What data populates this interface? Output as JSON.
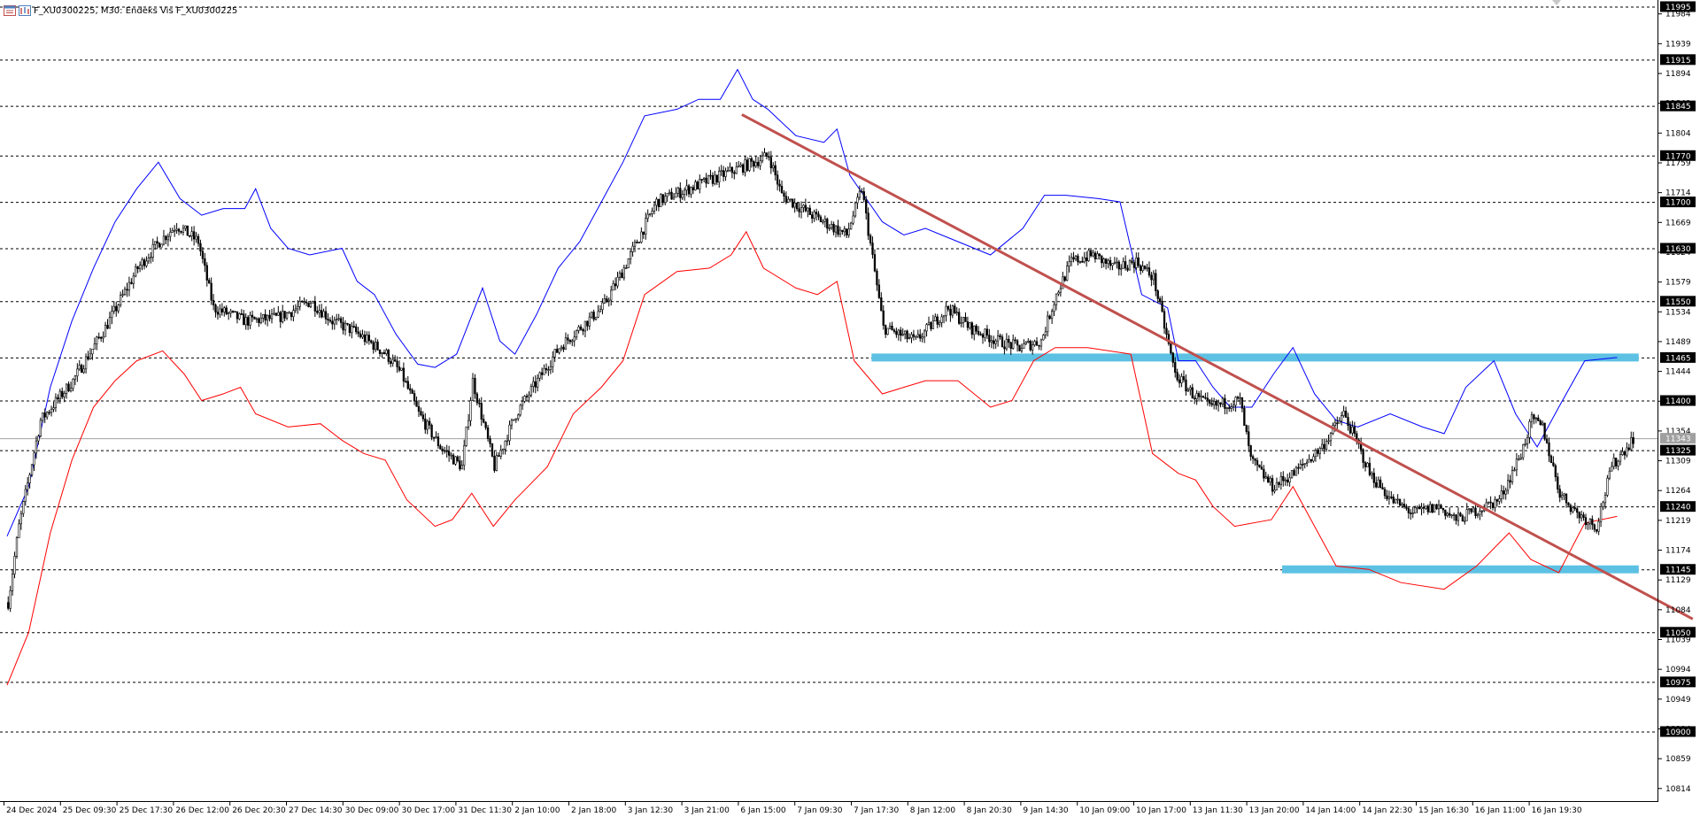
{
  "window": {
    "title": "F_XU0300225, M30:  Endeks Vis F_XU0300225",
    "icons": [
      "chart-window-icon",
      "indicator-list-icon"
    ]
  },
  "colors": {
    "candle": "#000000",
    "upper_band": "#0000ff",
    "lower_band": "#ff0000",
    "trendline": "#c0504d",
    "zone": "#5dc1e3",
    "grid": "#000000",
    "price_line": "#a0a0a0"
  },
  "chart_data": {
    "type": "candlestick",
    "symbol": "F_XU0300225",
    "timeframe": "M30",
    "title": "F_XU0300225, M30:  Endeks Vis F_XU0300225",
    "ylim": [
      10795,
      12005
    ],
    "y_tick_labels": [
      11984,
      11939,
      11894,
      11849,
      11804,
      11759,
      11714,
      11669,
      11624,
      11579,
      11534,
      11489,
      11444,
      11399,
      11354,
      11309,
      11264,
      11219,
      11174,
      11129,
      11084,
      11039,
      10994,
      10949,
      10904,
      10859,
      10814
    ],
    "horizontal_levels": [
      11995,
      11915,
      11845,
      11770,
      11700,
      11630,
      11550,
      11465,
      11400,
      11325,
      11240,
      11145,
      11050,
      10975,
      10900
    ],
    "current_price": 11343,
    "x_labels": [
      "24 Dec 2024",
      "25 Dec 09:30",
      "25 Dec 17:30",
      "26 Dec 12:00",
      "26 Dec 20:30",
      "27 Dec 14:30",
      "30 Dec 09:00",
      "30 Dec 17:00",
      "31 Dec 11:30",
      "2 Jan 10:00",
      "2 Jan 18:00",
      "3 Jan 12:30",
      "3 Jan 21:00",
      "6 Jan 15:00",
      "7 Jan 09:30",
      "7 Jan 17:30",
      "8 Jan 12:00",
      "8 Jan 20:30",
      "9 Jan 14:30",
      "10 Jan 09:00",
      "10 Jan 17:00",
      "13 Jan 11:30",
      "13 Jan 20:00",
      "14 Jan 14:00",
      "14 Jan 22:30",
      "15 Jan 16:30",
      "16 Jan 11:00",
      "16 Jan 19:30"
    ],
    "close_path": [
      [
        0,
        11095
      ],
      [
        5,
        11210
      ],
      [
        15,
        11370
      ],
      [
        30,
        11430
      ],
      [
        45,
        11510
      ],
      [
        60,
        11600
      ],
      [
        70,
        11640
      ],
      [
        78,
        11665
      ],
      [
        88,
        11640
      ],
      [
        95,
        11540
      ],
      [
        110,
        11520
      ],
      [
        125,
        11525
      ],
      [
        140,
        11550
      ],
      [
        150,
        11520
      ],
      [
        160,
        11505
      ],
      [
        175,
        11470
      ],
      [
        182,
        11440
      ],
      [
        190,
        11380
      ],
      [
        200,
        11330
      ],
      [
        210,
        11300
      ],
      [
        215,
        11430
      ],
      [
        225,
        11300
      ],
      [
        235,
        11380
      ],
      [
        255,
        11480
      ],
      [
        268,
        11520
      ],
      [
        275,
        11540
      ],
      [
        285,
        11600
      ],
      [
        300,
        11700
      ],
      [
        315,
        11720
      ],
      [
        330,
        11740
      ],
      [
        345,
        11760
      ],
      [
        352,
        11770
      ],
      [
        358,
        11710
      ],
      [
        372,
        11680
      ],
      [
        388,
        11650
      ],
      [
        395,
        11720
      ],
      [
        405,
        11510
      ],
      [
        420,
        11490
      ],
      [
        435,
        11540
      ],
      [
        445,
        11510
      ],
      [
        458,
        11490
      ],
      [
        468,
        11480
      ],
      [
        478,
        11490
      ],
      [
        485,
        11560
      ],
      [
        492,
        11610
      ],
      [
        502,
        11620
      ],
      [
        512,
        11600
      ],
      [
        522,
        11610
      ],
      [
        530,
        11585
      ],
      [
        540,
        11440
      ],
      [
        548,
        11410
      ],
      [
        556,
        11390
      ],
      [
        562,
        11395
      ],
      [
        570,
        11400
      ],
      [
        575,
        11310
      ],
      [
        585,
        11270
      ],
      [
        595,
        11290
      ],
      [
        608,
        11330
      ],
      [
        618,
        11380
      ],
      [
        625,
        11330
      ],
      [
        630,
        11290
      ],
      [
        640,
        11250
      ],
      [
        650,
        11230
      ],
      [
        662,
        11240
      ],
      [
        670,
        11220
      ],
      [
        680,
        11235
      ],
      [
        690,
        11250
      ],
      [
        700,
        11320
      ],
      [
        705,
        11370
      ],
      [
        710,
        11360
      ],
      [
        718,
        11260
      ],
      [
        726,
        11230
      ],
      [
        735,
        11210
      ],
      [
        742,
        11300
      ],
      [
        752,
        11343
      ]
    ],
    "bands": {
      "upper": [
        [
          0,
          11195
        ],
        [
          10,
          11270
        ],
        [
          20,
          11420
        ],
        [
          30,
          11520
        ],
        [
          40,
          11600
        ],
        [
          50,
          11670
        ],
        [
          60,
          11720
        ],
        [
          70,
          11760
        ],
        [
          80,
          11705
        ],
        [
          90,
          11680
        ],
        [
          100,
          11690
        ],
        [
          110,
          11690
        ],
        [
          115,
          11720
        ],
        [
          122,
          11660
        ],
        [
          130,
          11630
        ],
        [
          140,
          11620
        ],
        [
          155,
          11630
        ],
        [
          162,
          11580
        ],
        [
          170,
          11560
        ],
        [
          180,
          11500
        ],
        [
          190,
          11455
        ],
        [
          198,
          11450
        ],
        [
          208,
          11470
        ],
        [
          220,
          11570
        ],
        [
          228,
          11490
        ],
        [
          235,
          11470
        ],
        [
          245,
          11530
        ],
        [
          255,
          11600
        ],
        [
          265,
          11640
        ],
        [
          275,
          11700
        ],
        [
          285,
          11760
        ],
        [
          295,
          11830
        ],
        [
          310,
          11840
        ],
        [
          320,
          11855
        ],
        [
          330,
          11855
        ],
        [
          338,
          11900
        ],
        [
          345,
          11855
        ],
        [
          352,
          11840
        ],
        [
          365,
          11800
        ],
        [
          378,
          11790
        ],
        [
          384,
          11810
        ],
        [
          390,
          11740
        ],
        [
          405,
          11670
        ],
        [
          415,
          11650
        ],
        [
          425,
          11660
        ],
        [
          440,
          11640
        ],
        [
          455,
          11620
        ],
        [
          470,
          11660
        ],
        [
          480,
          11710
        ],
        [
          490,
          11710
        ],
        [
          505,
          11705
        ],
        [
          515,
          11700
        ],
        [
          525,
          11560
        ],
        [
          537,
          11540
        ],
        [
          542,
          11460
        ],
        [
          550,
          11460
        ],
        [
          558,
          11420
        ],
        [
          566,
          11390
        ],
        [
          576,
          11390
        ],
        [
          586,
          11440
        ],
        [
          595,
          11480
        ],
        [
          605,
          11410
        ],
        [
          615,
          11370
        ],
        [
          625,
          11360
        ],
        [
          640,
          11380
        ],
        [
          655,
          11360
        ],
        [
          665,
          11350
        ],
        [
          675,
          11420
        ],
        [
          688,
          11460
        ],
        [
          698,
          11380
        ],
        [
          708,
          11330
        ],
        [
          718,
          11390
        ],
        [
          730,
          11460
        ],
        [
          745,
          11465
        ]
      ],
      "lower": [
        [
          0,
          10970
        ],
        [
          10,
          11050
        ],
        [
          20,
          11200
        ],
        [
          30,
          11310
        ],
        [
          40,
          11390
        ],
        [
          50,
          11430
        ],
        [
          60,
          11460
        ],
        [
          72,
          11475
        ],
        [
          82,
          11440
        ],
        [
          90,
          11400
        ],
        [
          100,
          11410
        ],
        [
          108,
          11420
        ],
        [
          115,
          11380
        ],
        [
          130,
          11360
        ],
        [
          145,
          11365
        ],
        [
          155,
          11340
        ],
        [
          165,
          11320
        ],
        [
          175,
          11310
        ],
        [
          185,
          11250
        ],
        [
          198,
          11210
        ],
        [
          206,
          11220
        ],
        [
          215,
          11260
        ],
        [
          225,
          11210
        ],
        [
          235,
          11250
        ],
        [
          250,
          11300
        ],
        [
          262,
          11380
        ],
        [
          275,
          11420
        ],
        [
          285,
          11460
        ],
        [
          295,
          11560
        ],
        [
          310,
          11595
        ],
        [
          325,
          11600
        ],
        [
          335,
          11620
        ],
        [
          342,
          11655
        ],
        [
          350,
          11600
        ],
        [
          365,
          11570
        ],
        [
          375,
          11560
        ],
        [
          384,
          11580
        ],
        [
          392,
          11460
        ],
        [
          405,
          11410
        ],
        [
          415,
          11420
        ],
        [
          425,
          11430
        ],
        [
          440,
          11430
        ],
        [
          455,
          11390
        ],
        [
          465,
          11400
        ],
        [
          475,
          11460
        ],
        [
          485,
          11480
        ],
        [
          500,
          11480
        ],
        [
          520,
          11470
        ],
        [
          530,
          11320
        ],
        [
          542,
          11290
        ],
        [
          550,
          11280
        ],
        [
          558,
          11240
        ],
        [
          568,
          11210
        ],
        [
          585,
          11220
        ],
        [
          595,
          11270
        ],
        [
          605,
          11210
        ],
        [
          615,
          11150
        ],
        [
          630,
          11145
        ],
        [
          645,
          11125
        ],
        [
          665,
          11115
        ],
        [
          680,
          11150
        ],
        [
          695,
          11200
        ],
        [
          705,
          11160
        ],
        [
          718,
          11140
        ],
        [
          730,
          11215
        ],
        [
          745,
          11225
        ]
      ]
    },
    "trendline": {
      "start": [
        340,
        11832
      ],
      "end": [
        780,
        11070
      ]
    },
    "zones": [
      {
        "name": "resistance-zone",
        "from_bar": 400,
        "to_bar": 755,
        "low": 11459,
        "high": 11471
      },
      {
        "name": "support-zone",
        "from_bar": 590,
        "to_bar": 755,
        "low": 11139,
        "high": 11151
      }
    ]
  }
}
